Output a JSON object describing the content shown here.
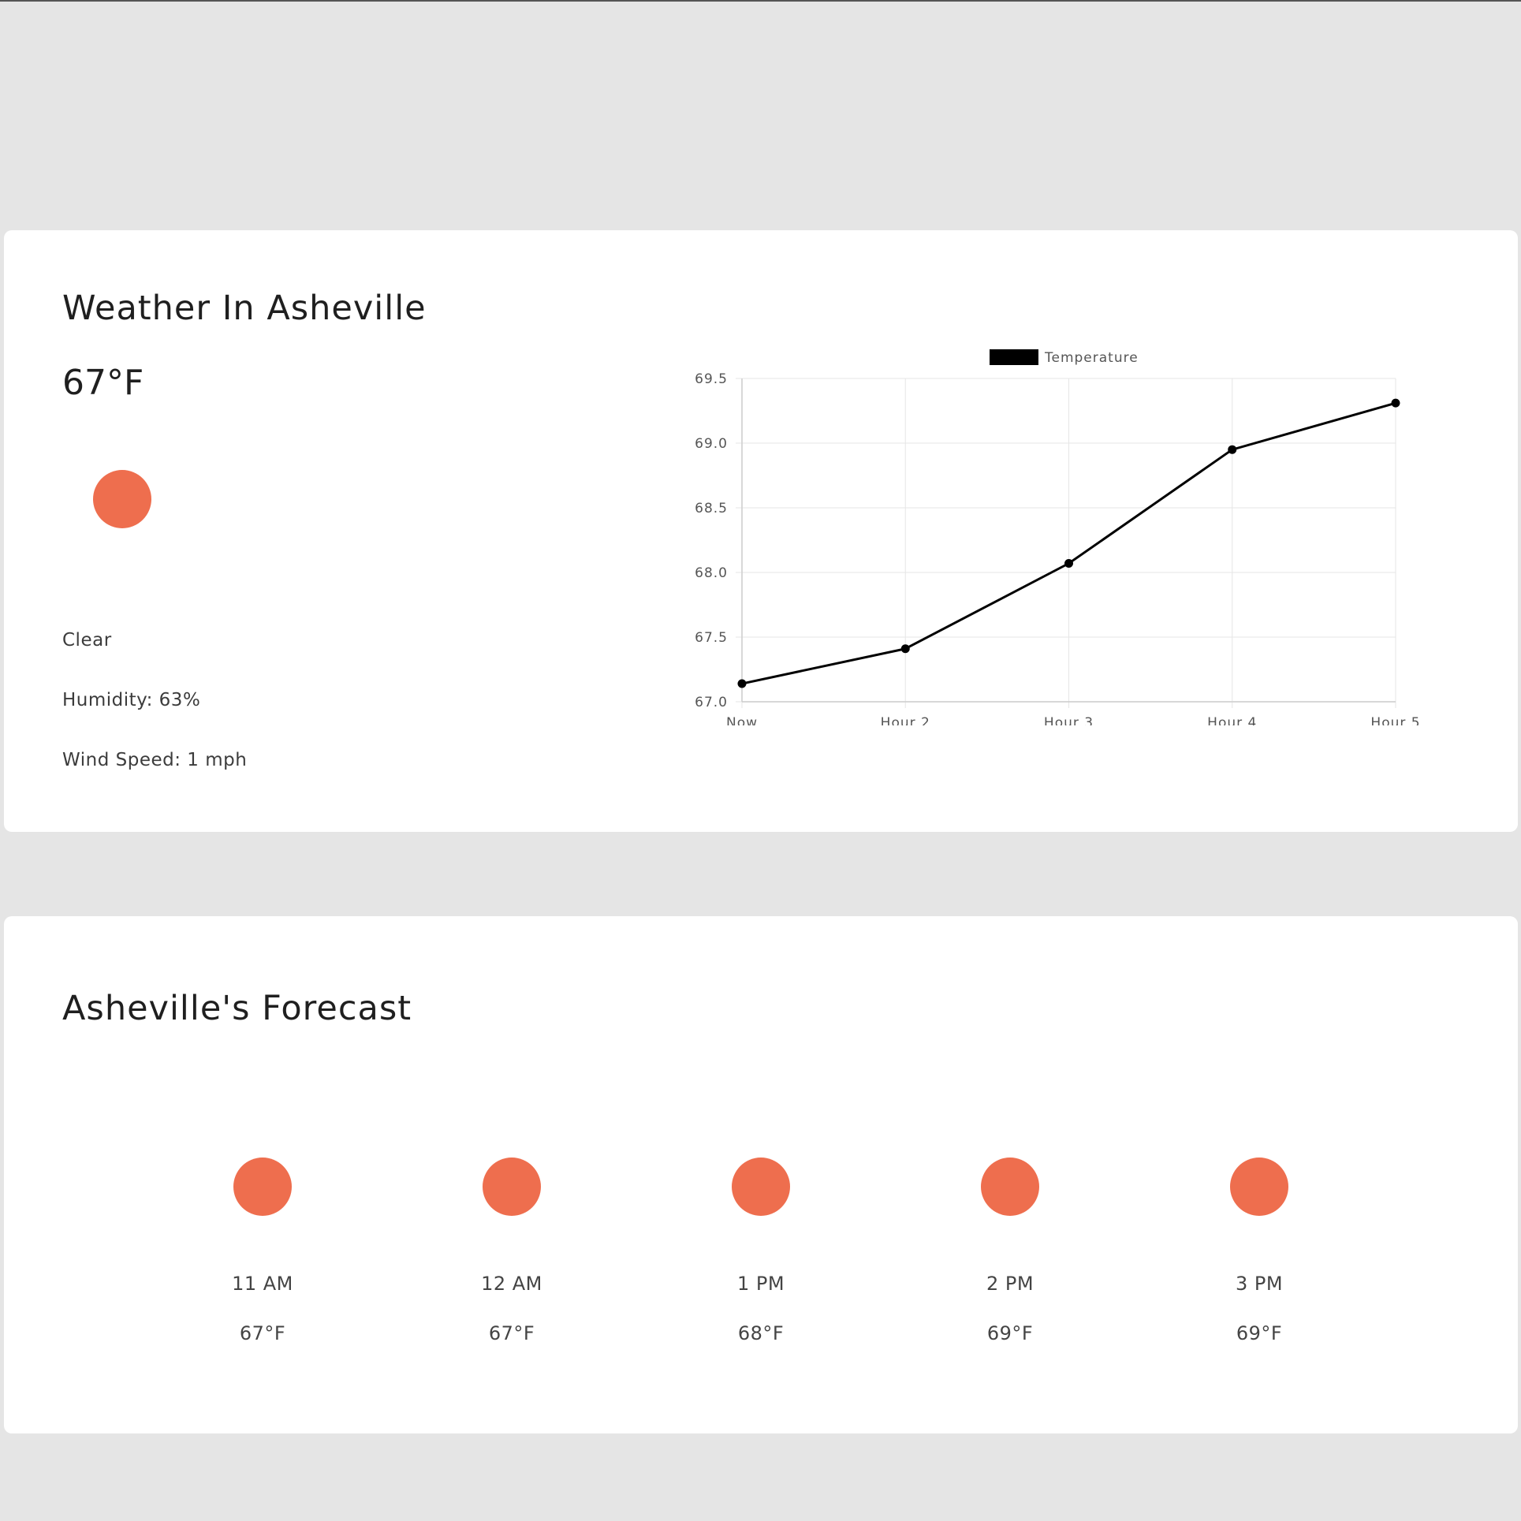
{
  "current": {
    "title": "Weather In Asheville",
    "temperature": "67°F",
    "icon": "sun-icon",
    "condition": "Clear",
    "humidity": "Humidity: 63%",
    "wind": "Wind Speed: 1 mph"
  },
  "forecast": {
    "title": "Asheville's Forecast",
    "items": [
      {
        "time": "11 AM",
        "temp": "67°F",
        "icon": "sun-icon"
      },
      {
        "time": "12 AM",
        "temp": "67°F",
        "icon": "sun-icon"
      },
      {
        "time": "1 PM",
        "temp": "68°F",
        "icon": "sun-icon"
      },
      {
        "time": "2 PM",
        "temp": "69°F",
        "icon": "sun-icon"
      },
      {
        "time": "3 PM",
        "temp": "69°F",
        "icon": "sun-icon"
      }
    ]
  },
  "colors": {
    "background": "#e5e5e5",
    "card": "#ffffff",
    "sun": "#ee6e4e",
    "line": "#000000",
    "grid": "#e6e6e6"
  },
  "chart_data": {
    "type": "line",
    "title": "",
    "xlabel": "",
    "ylabel": "",
    "categories": [
      "Now",
      "Hour 2",
      "Hour 3",
      "Hour 4",
      "Hour 5"
    ],
    "series": [
      {
        "name": "Temperature",
        "values": [
          67.14,
          67.41,
          68.07,
          68.95,
          69.31
        ]
      }
    ],
    "ylim": [
      67.0,
      69.5
    ],
    "yticks": [
      "67.0",
      "67.5",
      "68.0",
      "68.5",
      "69.0",
      "69.5"
    ],
    "grid": true,
    "legend": "top-center"
  }
}
